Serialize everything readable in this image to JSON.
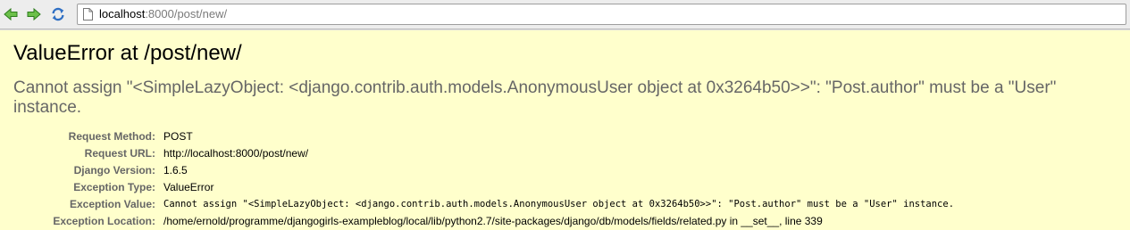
{
  "browser": {
    "url_host": "localhost",
    "url_rest": ":8000/post/new/",
    "icons": {
      "back": "back-arrow-icon",
      "forward": "forward-arrow-icon",
      "reload": "reload-icon",
      "page": "page-icon"
    }
  },
  "error": {
    "title": "ValueError at /post/new/",
    "message": "Cannot assign \"<SimpleLazyObject: <django.contrib.auth.models.AnonymousUser object at 0x3264b50>>\": \"Post.author\" must be a \"User\" instance."
  },
  "meta": [
    {
      "label": "Request Method:",
      "value": "POST"
    },
    {
      "label": "Request URL:",
      "value": "http://localhost:8000/post/new/"
    },
    {
      "label": "Django Version:",
      "value": "1.6.5"
    },
    {
      "label": "Exception Type:",
      "value": "ValueError"
    },
    {
      "label": "Exception Value:",
      "value": "Cannot assign \"<SimpleLazyObject: <django.contrib.auth.models.AnonymousUser object at 0x3264b50>>\": \"Post.author\" must be a \"User\" instance."
    },
    {
      "label": "Exception Location:",
      "value": "/home/ernold/programme/djangogirls-exampleblog/local/lib/python2.7/site-packages/django/db/models/fields/related.py in __set__, line 339"
    }
  ],
  "colors": {
    "page_background": "#ffffcc",
    "toolbar": "#ededed",
    "arrow_green": "#3a9b2a",
    "reload_blue": "#2f6fc4",
    "label_gray": "#666666"
  }
}
